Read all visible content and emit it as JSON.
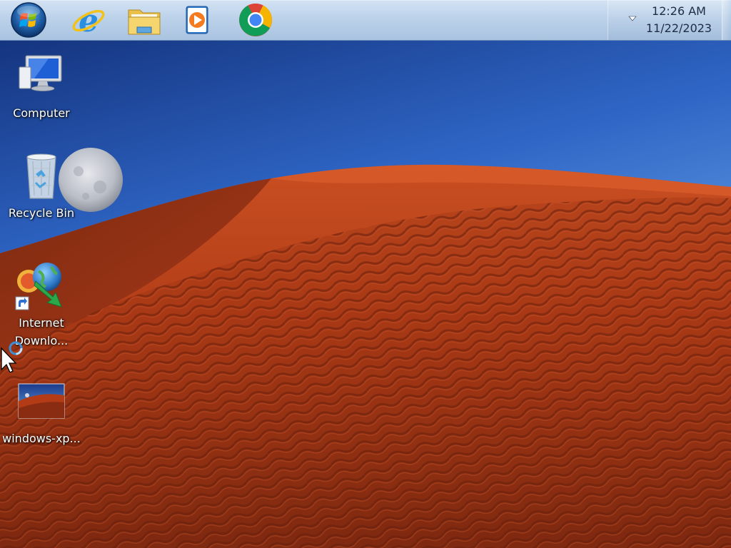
{
  "taskbar": {
    "pinned": [
      {
        "name": "start-button",
        "label": "Start"
      },
      {
        "name": "internet-explorer",
        "label": "Internet Explorer"
      },
      {
        "name": "windows-explorer",
        "label": "Windows Explorer"
      },
      {
        "name": "windows-media-player",
        "label": "Windows Media Player"
      },
      {
        "name": "google-chrome",
        "label": "Google Chrome"
      }
    ],
    "clock": {
      "time": "12:26 AM",
      "date": "11/22/2023"
    }
  },
  "desktop": {
    "icons": [
      {
        "label": "Computer",
        "icon": "computer-icon"
      },
      {
        "label": "Recycle Bin",
        "icon": "recycle-bin-icon"
      },
      {
        "label_line1": "Internet",
        "label_line2": "Downlo...",
        "icon": "internet-download-manager-icon"
      },
      {
        "label": "windows-xp...",
        "icon": "image-file-icon"
      }
    ]
  },
  "colors": {
    "taskbar_top": "#d3e3f3",
    "taskbar_bottom": "#a9c3e0",
    "sky_top": "#1c3f8f",
    "sky_horizon": "#5aa0e8",
    "dune": "#b8401a",
    "dune_shadow": "#6e2410",
    "moon": "#c9ccd2",
    "label_text": "#ffffff",
    "clock_text": "#1d2c44"
  }
}
